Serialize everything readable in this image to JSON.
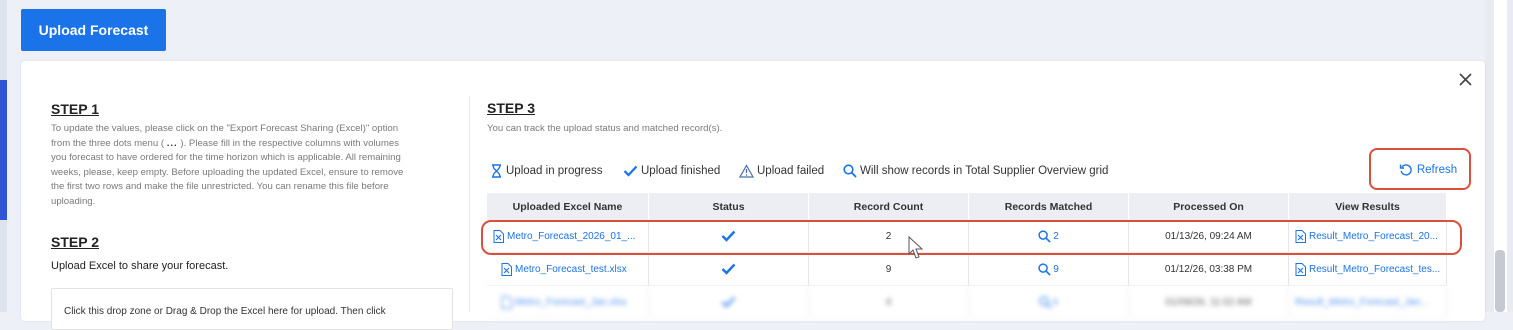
{
  "toolbar": {
    "upload_label": "Upload Forecast"
  },
  "step1": {
    "title": "STEP 1",
    "line1": "To update the values, please click on the \"Export Forecast Sharing (Excel)\" option",
    "line2a": "from the three dots menu (",
    "dots": "...",
    "line2b": "). Please fill in the respective columns with volumes",
    "line3": "you forecast to have ordered for the time horizon which is applicable. All remaining",
    "line4": "weeks, please, keep empty. Before uploading the updated Excel, ensure to remove",
    "line5": "the first two rows and make the file unrestricted. You can rename this file before",
    "line6": "uploading."
  },
  "step2": {
    "title": "STEP 2",
    "text": "Upload Excel to share your forecast.",
    "dropzone_text": "Click this drop zone or Drag & Drop the Excel here for upload. Then click"
  },
  "step3": {
    "title": "STEP 3",
    "subtitle": "You can track the upload status and matched record(s).",
    "legend": {
      "in_progress": "Upload in progress",
      "finished": "Upload finished",
      "failed": "Upload failed",
      "records": "Will show records in Total Supplier Overview grid"
    },
    "refresh_label": "Refresh"
  },
  "table": {
    "headers": [
      "Uploaded Excel Name",
      "Status",
      "Record Count",
      "Records Matched",
      "Processed On",
      "View Results"
    ],
    "rows": [
      {
        "name": "Metro_Forecast_2026_01_...",
        "status": "finished",
        "count": "2",
        "matched": "2",
        "processed": "01/13/26, 09:24 AM",
        "result": "Result_Metro_Forecast_20..."
      },
      {
        "name": "Metro_Forecast_test.xlsx",
        "status": "finished",
        "count": "9",
        "matched": "9",
        "processed": "01/12/26, 03:38 PM",
        "result": "Result_Metro_Forecast_tes..."
      },
      {
        "name": "Metro_Forecast_Jan.xlsx",
        "status": "finished",
        "count": "4",
        "matched": "4",
        "processed": "01/09/26, 11:02 AM",
        "result": "Result_Metro_Forecast_Jan..."
      }
    ]
  },
  "colors": {
    "primary": "#1a73e8",
    "highlight": "#d9513b",
    "panel_bg": "#ffffff",
    "page_bg": "#eef0f8",
    "header_bg": "#eceef4"
  },
  "icons": {
    "close": "close-icon",
    "in_progress": "hourglass-icon",
    "finished": "checkmark-icon",
    "failed": "warning-triangle-icon",
    "records": "search-icon",
    "refresh": "refresh-icon",
    "excel_file": "excel-file-icon"
  }
}
